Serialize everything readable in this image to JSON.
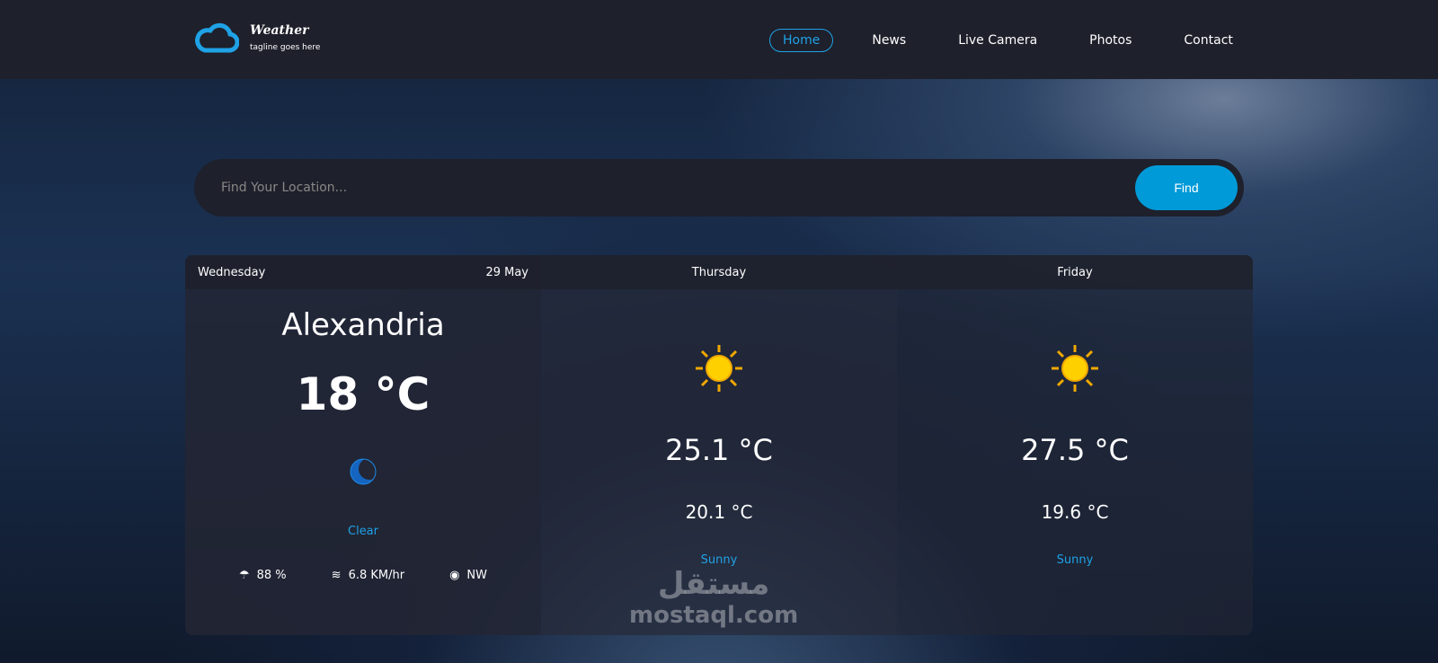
{
  "header": {
    "brand": "Weather",
    "tagline": "tagline goes here",
    "nav": [
      "Home",
      "News",
      "Live Camera",
      "Photos",
      "Contact"
    ],
    "active": "Home"
  },
  "search": {
    "placeholder": "Find Your Location...",
    "button": "Find"
  },
  "today": {
    "day": "Wednesday",
    "date": "29 May",
    "city": "Alexandria",
    "temp": "18 °C",
    "condition": "Clear",
    "icon": "moon-icon",
    "humidity": "88 %",
    "wind": "6.8 KM/hr",
    "direction": "NW"
  },
  "forecast": [
    {
      "day": "Thursday",
      "max": "25.1 °C",
      "min": "20.1 °C",
      "condition": "Sunny",
      "icon": "sun-icon"
    },
    {
      "day": "Friday",
      "max": "27.5 °C",
      "min": "19.6 °C",
      "condition": "Sunny",
      "icon": "sun-icon"
    }
  ],
  "watermark": {
    "arabic": "مستقل",
    "latin": "mostaql.com"
  },
  "colors": {
    "accent": "#009ad8",
    "header": "#1e202b"
  }
}
